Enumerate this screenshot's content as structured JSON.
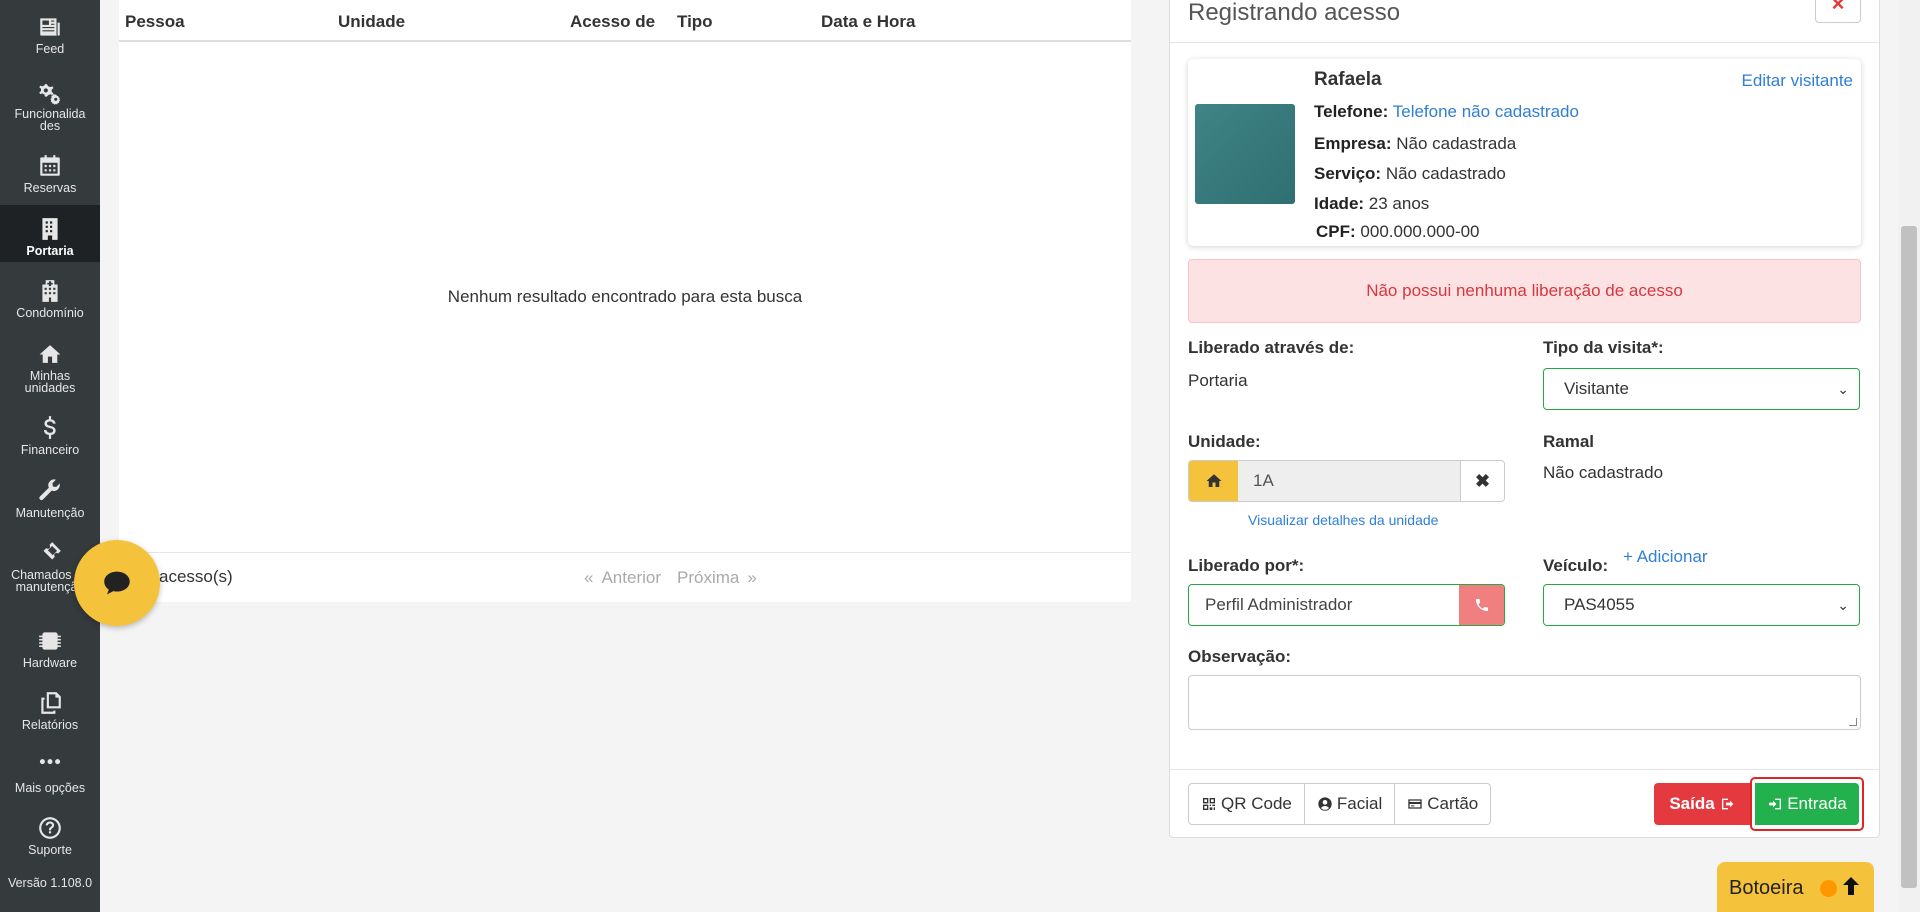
{
  "sidebar": {
    "items": [
      {
        "label": "Feed",
        "icon": "newspaper-icon"
      },
      {
        "label": "Funcionalida des",
        "icon": "gears-icon"
      },
      {
        "label": "Reservas",
        "icon": "calendar-icon"
      },
      {
        "label": "Portaria",
        "icon": "building-icon",
        "active": true
      },
      {
        "label": "Condomínio",
        "icon": "hospital-building-icon"
      },
      {
        "label": "Minhas unidades",
        "icon": "home-icon"
      },
      {
        "label": "Financeiro",
        "icon": "dollar-icon"
      },
      {
        "label": "Manutenção",
        "icon": "wrench-icon"
      },
      {
        "label": "Chamados de manutenção",
        "icon": "ticket-icon"
      },
      {
        "label": "Hardware",
        "icon": "chip-icon"
      },
      {
        "label": "Relatórios",
        "icon": "copy-icon"
      },
      {
        "label": "Mais opções",
        "icon": "ellipsis-icon"
      },
      {
        "label": "Suporte",
        "icon": "question-circle-icon"
      }
    ],
    "version": "Versão 1.108.0"
  },
  "table": {
    "columns": [
      "Pessoa",
      "Unidade",
      "Acesso de",
      "Tipo",
      "Data e Hora"
    ],
    "empty_message": "Nenhum resultado encontrado para esta busca",
    "count_text": "acesso(s)",
    "pager": {
      "prev_symbol": "«",
      "prev": "Anterior",
      "next": "Próxima",
      "next_symbol": "»"
    }
  },
  "modal": {
    "title": "Registrando acesso",
    "close_symbol": "×",
    "visitor": {
      "name": "Rafaela",
      "edit_label": "Editar visitante",
      "telefone_label": "Telefone:",
      "telefone_value": "Telefone não cadastrado",
      "empresa_label": "Empresa:",
      "empresa_value": "Não cadastrada",
      "servico_label": "Serviço:",
      "servico_value": "Não cadastrado",
      "idade_label": "Idade:",
      "idade_value": "23 anos",
      "cpf_label": "CPF:",
      "cpf_value": "000.000.000-00"
    },
    "alert": "Não possui nenhuma liberação de acesso",
    "liberado_atraves_label": "Liberado através de:",
    "liberado_atraves_value": "Portaria",
    "tipo_visita_label": "Tipo da visita*:",
    "tipo_visita_value": "Visitante",
    "unidade_label": "Unidade:",
    "unidade_value": "1A",
    "unidade_clear": "✖",
    "unidade_link": "Visualizar detalhes da unidade",
    "ramal_label": "Ramal",
    "ramal_value": "Não cadastrado",
    "liberado_por_label": "Liberado por*:",
    "liberado_por_value": "Perfil Administrador",
    "veiculo_label": "Veículo:",
    "veiculo_add": "+ Adicionar",
    "veiculo_value": "PAS4055",
    "observacao_label": "Observação:",
    "observacao_value": "",
    "buttons": {
      "qrcode": "QR Code",
      "facial": "Facial",
      "cartao": "Cartão",
      "saida": "Saída",
      "entrada": "Entrada"
    }
  },
  "botoeira": {
    "label": "Botoeira"
  },
  "colors": {
    "sidebar_bg": "#353a3d",
    "accent_yellow": "#f5c33b",
    "success_green": "#22b14c",
    "danger_red": "#e53940",
    "link_blue": "#2f7fd6"
  }
}
